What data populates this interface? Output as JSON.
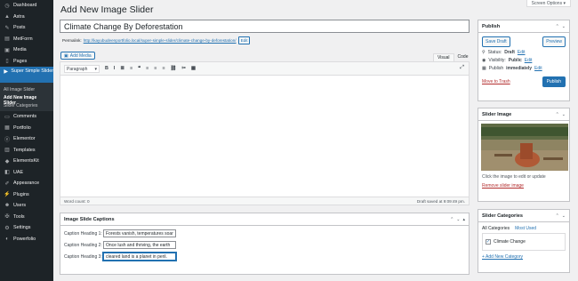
{
  "sidebar": {
    "items": [
      {
        "label": "Dashboard",
        "icon": "dashboard-icon",
        "glyph": "◷"
      },
      {
        "label": "Astra",
        "icon": "astra-icon",
        "glyph": "▲"
      },
      {
        "label": "Posts",
        "icon": "pin-icon",
        "glyph": "✎"
      },
      {
        "label": "MetForm",
        "icon": "form-icon",
        "glyph": "▤"
      },
      {
        "label": "Media",
        "icon": "media-icon",
        "glyph": "▣"
      },
      {
        "label": "Pages",
        "icon": "page-icon",
        "glyph": "▯"
      }
    ],
    "active": {
      "label": "Super Simple Slider",
      "icon": "slider-icon",
      "glyph": "▶"
    },
    "sub": [
      "All Image Slider",
      "Add New Image Slider",
      "Slider Categories"
    ],
    "items_after": [
      {
        "label": "Comments",
        "icon": "comment-icon",
        "glyph": "▭"
      },
      {
        "label": "Portfolio",
        "icon": "portfolio-icon",
        "glyph": "▦"
      },
      {
        "label": "Elementor",
        "icon": "elementor-icon",
        "glyph": "ⓔ"
      },
      {
        "label": "Templates",
        "icon": "folder-icon",
        "glyph": "▥"
      },
      {
        "label": "ElementsKit",
        "icon": "elementskit-icon",
        "glyph": "◆"
      },
      {
        "label": "UAE",
        "icon": "uae-icon",
        "glyph": "◧"
      },
      {
        "label": "Appearance",
        "icon": "brush-icon",
        "glyph": "✐"
      },
      {
        "label": "Plugins",
        "icon": "plugin-icon",
        "glyph": "⚡"
      },
      {
        "label": "Users",
        "icon": "user-icon",
        "glyph": "☻"
      },
      {
        "label": "Tools",
        "icon": "wrench-icon",
        "glyph": "✠"
      },
      {
        "label": "Settings",
        "icon": "settings-icon",
        "glyph": "⚙"
      },
      {
        "label": "Powerfolio",
        "icon": "powerfolio-icon",
        "glyph": "◐"
      }
    ]
  },
  "screen_options": "Screen Options ▾",
  "page_title": "Add New Image Slider",
  "post_title": "Climate Change By Deforestation",
  "permalink": {
    "label": "Permalink:",
    "url": "http://kayubudeenportfolio.local/super-simple-slider/climate-change-by-deforestation/",
    "edit": "Edit"
  },
  "add_media": "Add Media",
  "editor_tabs": [
    "Visual",
    "Code"
  ],
  "format_select": "Paragraph",
  "toolbar_glyphs": [
    "B",
    "I",
    "≣",
    "≡",
    "❝",
    "≡",
    "≡",
    "≡",
    "⛓",
    "✂",
    "▦"
  ],
  "word_count": "Word count: 0",
  "draft_saved": "Draft saved at 9:09:49 pm.",
  "captions": {
    "title": "Image Slide Captions",
    "rows": [
      {
        "label": "Caption Heading 1:",
        "value": "Forests vanish, temperatures soar"
      },
      {
        "label": "Caption Heading 2:",
        "value": "Once lush and thriving, the earth"
      },
      {
        "label": "Caption Heading 3:",
        "value": "cleared land is a planet in peril."
      }
    ]
  },
  "publish": {
    "title": "Publish",
    "save_draft": "Save Draft",
    "preview": "Preview",
    "status_label": "Status:",
    "status_value": "Draft",
    "visibility_label": "Visibility:",
    "visibility_value": "Public",
    "publish_label": "Publish",
    "publish_value": "immediately",
    "edit": "Edit",
    "trash": "Move to Trash",
    "button": "Publish"
  },
  "slider_image": {
    "title": "Slider Image",
    "hint": "Click the image to edit or update",
    "remove": "Remove slider image"
  },
  "slider_categories": {
    "title": "Slider Categories",
    "tabs": [
      "All Categories",
      "Most Used"
    ],
    "item": "Climate Change",
    "add": "+ Add New Category"
  }
}
